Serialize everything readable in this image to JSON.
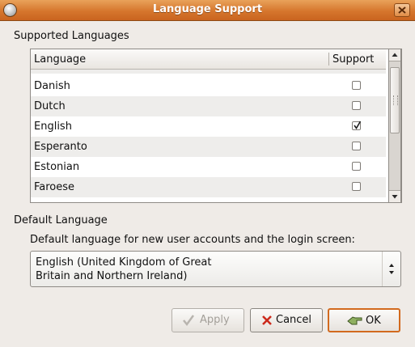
{
  "window": {
    "title": "Language Support"
  },
  "supported": {
    "heading": "Supported Languages",
    "columns": {
      "language": "Language",
      "support": "Support"
    },
    "rows": [
      {
        "language": "Danish",
        "checked": false
      },
      {
        "language": "Dutch",
        "checked": false
      },
      {
        "language": "English",
        "checked": true
      },
      {
        "language": "Esperanto",
        "checked": false
      },
      {
        "language": "Estonian",
        "checked": false
      },
      {
        "language": "Faroese",
        "checked": false
      }
    ]
  },
  "default_language": {
    "heading": "Default Language",
    "description": "Default language for new user accounts and the login screen:",
    "selected_line1": "English (United Kingdom of Great",
    "selected_line2": "Britain and Northern Ireland)"
  },
  "buttons": {
    "apply": "Apply",
    "cancel": "Cancel",
    "ok": "OK"
  },
  "icons": {
    "window_menu": "window-menu-icon",
    "close": "close-icon",
    "apply": "checkmark-icon",
    "cancel": "cancel-x-icon",
    "ok": "ok-hand-icon",
    "combo": "up-down-arrows-icon"
  },
  "colors": {
    "titlebar": "#d6762d",
    "default_button_border": "#d26a1e",
    "cancel_icon": "#cc2a1c"
  }
}
